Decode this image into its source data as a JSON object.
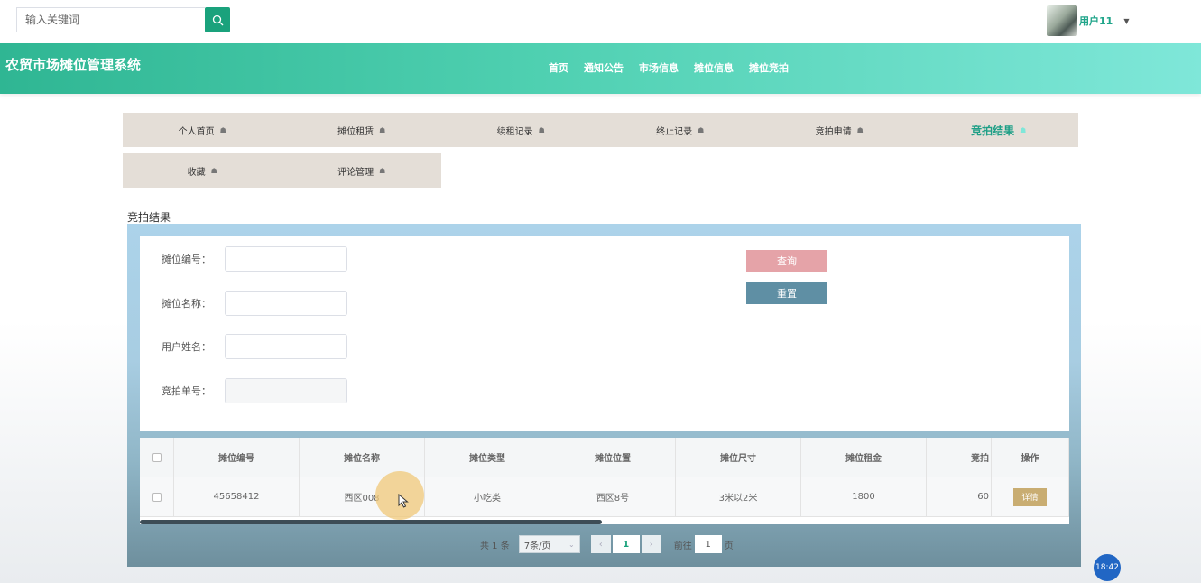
{
  "search": {
    "placeholder": "输入关键词"
  },
  "user": {
    "name": "用户11"
  },
  "site": {
    "title": "农贸市场摊位管理系统"
  },
  "nav": [
    "首页",
    "通知公告",
    "市场信息",
    "摊位信息",
    "摊位竞拍"
  ],
  "tabs": [
    "个人首页",
    "摊位租赁",
    "续租记录",
    "终止记录",
    "竞拍申请",
    "竞拍结果"
  ],
  "tabs2": [
    "收藏",
    "评论管理"
  ],
  "section": {
    "title": "竞拍结果"
  },
  "form": {
    "labels": [
      "摊位编号：",
      "摊位名称：",
      "用户姓名：",
      "竞拍单号："
    ],
    "query_label": "查询",
    "reset_label": "重置"
  },
  "table": {
    "headers": [
      "摊位编号",
      "摊位名称",
      "摊位类型",
      "摊位位置",
      "摊位尺寸",
      "摊位租金",
      "竞拍",
      "操作"
    ],
    "rows": [
      [
        "45658412",
        "西区008",
        "小吃类",
        "西区8号",
        "3米以2米",
        "1800",
        "60",
        "详情"
      ]
    ]
  },
  "pager": {
    "total": "共 1 条",
    "size": "7条/页",
    "current": "1",
    "goto": "前往",
    "goto_value": "1",
    "unit": "页"
  },
  "clock": "18:42",
  "colors": {
    "accent": "#1aa27c",
    "banner": "#4fd0b1",
    "query": "#e5a3a8",
    "reset": "#5f8fa4",
    "detail": "#c9ad72"
  }
}
